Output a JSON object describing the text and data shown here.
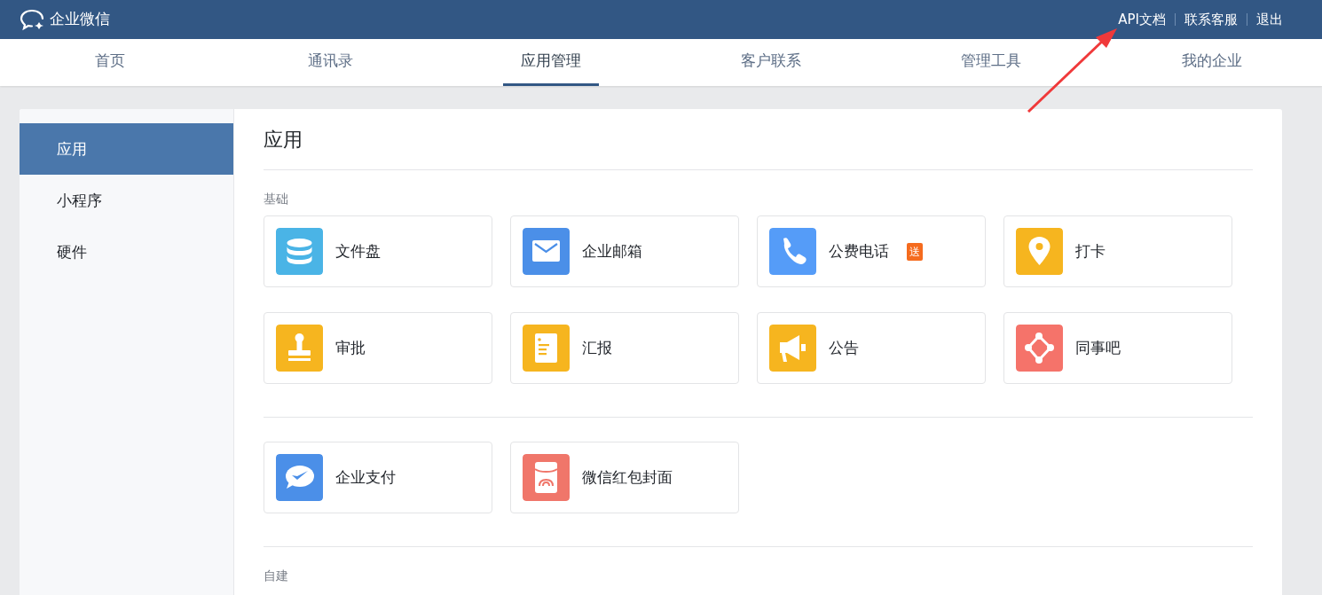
{
  "brand": {
    "name": "企业微信"
  },
  "top_links": [
    {
      "label": "API文档"
    },
    {
      "label": "联系客服"
    },
    {
      "label": "退出"
    }
  ],
  "tabs": [
    {
      "label": "首页",
      "selected": false
    },
    {
      "label": "通讯录",
      "selected": false
    },
    {
      "label": "应用管理",
      "selected": true
    },
    {
      "label": "客户联系",
      "selected": false
    },
    {
      "label": "管理工具",
      "selected": false
    },
    {
      "label": "我的企业",
      "selected": false
    }
  ],
  "sidebar": {
    "items": [
      {
        "label": "应用",
        "selected": true
      },
      {
        "label": "小程序",
        "selected": false
      },
      {
        "label": "硬件",
        "selected": false
      }
    ]
  },
  "content": {
    "title": "应用",
    "sections": [
      {
        "label": "基础",
        "apps": [
          {
            "name": "文件盘",
            "kind": "database",
            "color": "#4ab4e6"
          },
          {
            "name": "企业邮箱",
            "kind": "mail",
            "color": "#4b8fe8"
          },
          {
            "name": "公费电话",
            "kind": "phone",
            "color": "#559cf8",
            "badge": "送"
          },
          {
            "name": "打卡",
            "kind": "pin",
            "color": "#f6b51f"
          },
          {
            "name": "审批",
            "kind": "stamp",
            "color": "#f6b51f"
          },
          {
            "name": "汇报",
            "kind": "report",
            "color": "#f6b51f"
          },
          {
            "name": "公告",
            "kind": "megaphone",
            "color": "#f6b51f"
          },
          {
            "name": "同事吧",
            "kind": "network",
            "color": "#f5736a"
          }
        ]
      },
      {
        "apps": [
          {
            "name": "企业支付",
            "kind": "pay",
            "color": "#4b8fe8"
          },
          {
            "name": "微信红包封面",
            "kind": "envelope",
            "color": "#f0766a"
          }
        ]
      },
      {
        "label": "自建"
      }
    ]
  },
  "annotation": {
    "kind": "arrow",
    "color": "#f0393a"
  }
}
